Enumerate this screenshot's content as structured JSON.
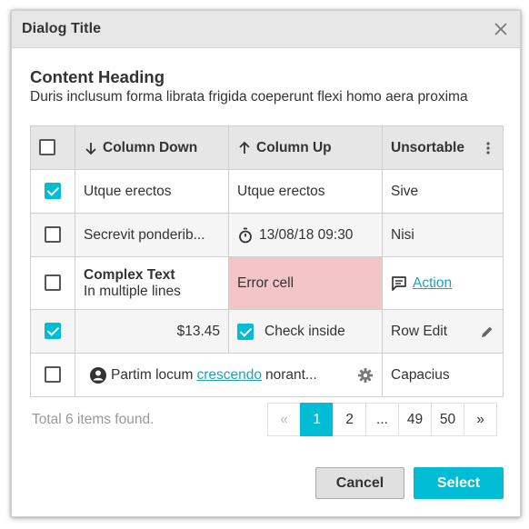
{
  "dialog": {
    "title": "Dialog Title",
    "content_heading": "Content Heading",
    "content_text": "Duris inclusum forma librata frigida coeperunt flexi homo aera proxima"
  },
  "table": {
    "headers": {
      "col1": "Column Down",
      "col2": "Column Up",
      "col3": "Unsortable"
    },
    "rows": [
      {
        "checked": true,
        "c1": "Utque erectos",
        "c2": "Utque erectos",
        "c3": "Sive"
      },
      {
        "checked": false,
        "c1": "Secrevit ponderib...",
        "c2": "13/08/18 09:30",
        "c3": "Nisi"
      },
      {
        "checked": false,
        "c1_bold": "Complex Text",
        "c1_sub": "In multiple lines",
        "c2": "Error cell",
        "c3": "Action"
      },
      {
        "checked": true,
        "c1": "$13.45",
        "c2": "Check inside",
        "c3": "Row Edit"
      },
      {
        "checked": false,
        "c1_pre": "Partim locum",
        "c1_link": "crescendo",
        "c1_post": "norant...",
        "c3": "Capacius"
      }
    ]
  },
  "footer": {
    "info": "Total 6 items found.",
    "pager": {
      "first": "«",
      "pages": [
        "1",
        "2",
        "...",
        "49",
        "50"
      ],
      "last": "»",
      "active": "1"
    }
  },
  "buttons": {
    "cancel": "Cancel",
    "select": "Select"
  },
  "colors": {
    "accent": "#00bcd4",
    "error_bg": "#f2c6c6",
    "link": "#1fa3b8"
  }
}
